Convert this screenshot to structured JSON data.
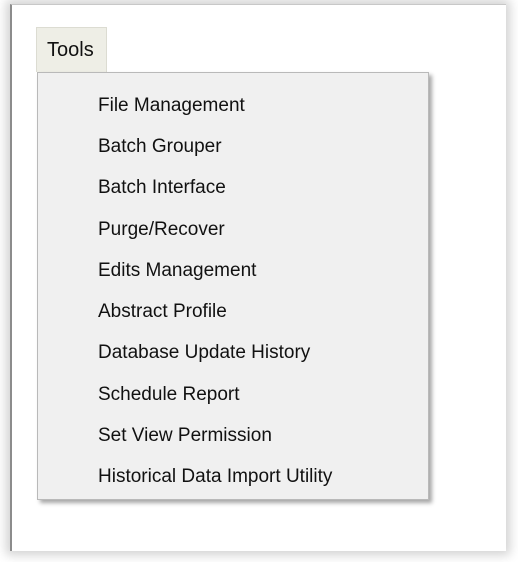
{
  "menubar": {
    "tools_label": "Tools"
  },
  "tools_menu": {
    "items": [
      {
        "label": "File Management"
      },
      {
        "label": "Batch Grouper"
      },
      {
        "label": "Batch Interface"
      },
      {
        "label": "Purge/Recover"
      },
      {
        "label": "Edits Management"
      },
      {
        "label": "Abstract Profile"
      },
      {
        "label": "Database Update History"
      },
      {
        "label": "Schedule Report"
      },
      {
        "label": "Set View Permission"
      },
      {
        "label": "Historical Data Import Utility"
      }
    ]
  }
}
